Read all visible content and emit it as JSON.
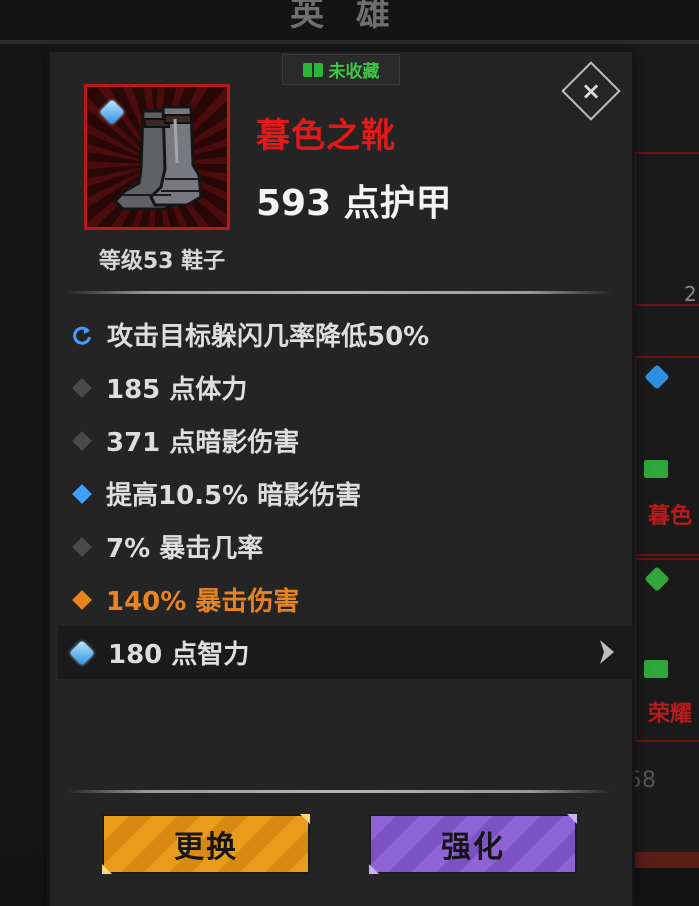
{
  "background": {
    "title": "英 雄",
    "card_label": "暮色",
    "card_label_2": "荣耀",
    "side_number": "2",
    "bottom_number": "58"
  },
  "tooltip": {
    "collection_tag": "未收藏",
    "close_symbol": "×",
    "item": {
      "name": "暮色之靴",
      "armor": "593 点护甲",
      "meta": "等级53 鞋子",
      "rarity_color": "#b81a1a",
      "name_color": "#e11919"
    },
    "stats": [
      {
        "text": "攻击目标躲闪几率降低50%",
        "icon": "cycle-icon"
      },
      {
        "text": "185 点体力",
        "icon": "grey-diamond-icon"
      },
      {
        "text": "371 点暗影伤害",
        "icon": "grey-diamond-icon"
      },
      {
        "text": "提高10.5% 暗影伤害",
        "icon": "blue-diamond-icon"
      },
      {
        "text": "7% 暴击几率",
        "icon": "grey-diamond-icon"
      },
      {
        "text": "140% 暴击伤害",
        "icon": "orange-diamond-icon",
        "color": "#e88320"
      },
      {
        "text": "180 点智力",
        "icon": "blue-gem-icon"
      }
    ],
    "buttons": {
      "swap": "更换",
      "upgrade": "强化"
    }
  }
}
